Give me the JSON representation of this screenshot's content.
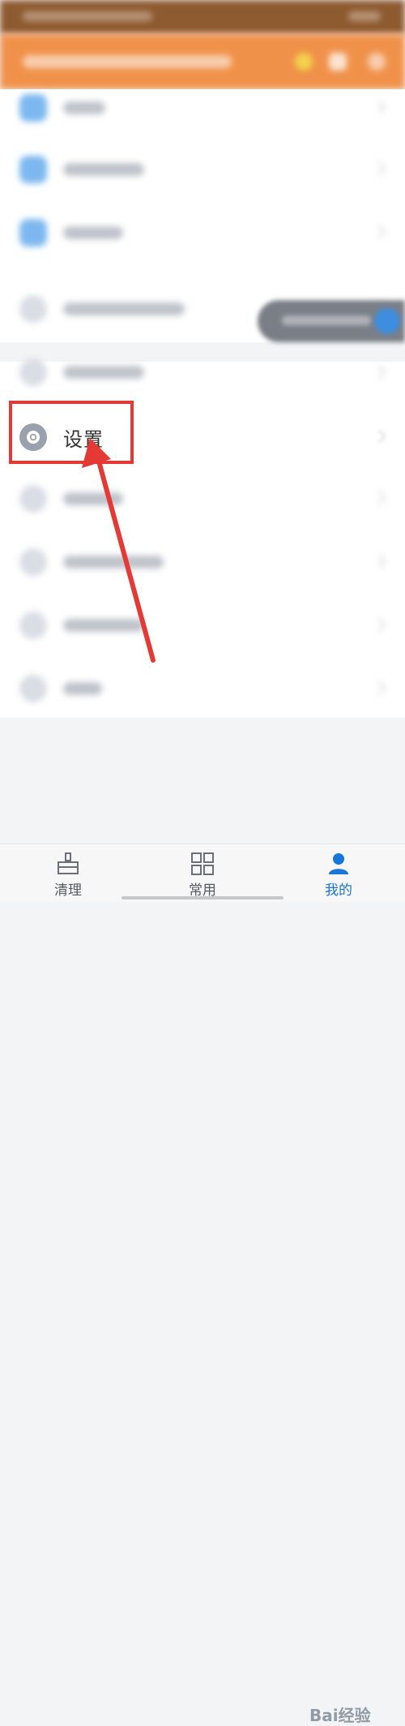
{
  "settings_item": {
    "label": "设置"
  },
  "tabs": [
    {
      "label": "清理",
      "icon": "broom-icon",
      "active": false
    },
    {
      "label": "常用",
      "icon": "grid-icon",
      "active": false
    },
    {
      "label": "我的",
      "icon": "profile-icon",
      "active": true
    }
  ],
  "watermark": {
    "text": "Bai经验"
  },
  "colors": {
    "header": "#f0914a",
    "accent": "#1677d8",
    "highlight": "#e53935"
  }
}
